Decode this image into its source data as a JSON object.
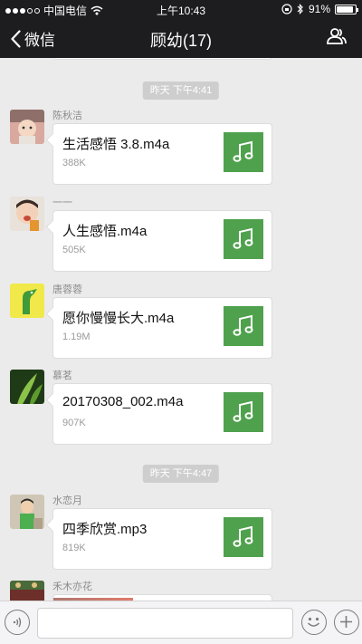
{
  "status_bar": {
    "carrier": "中国电信",
    "time": "上午10:43",
    "battery": "91%",
    "battery_level": 0.91
  },
  "nav": {
    "back_label": "微信",
    "title": "顾幼(17)"
  },
  "timestamps": [
    "昨天 下午4:41",
    "昨天 下午4:47"
  ],
  "messages": [
    {
      "sender": "陈秋洁",
      "file_name": "生活感悟 3.8.m4a",
      "file_size": "388K",
      "file_icon": "music-note-icon"
    },
    {
      "sender": "一一",
      "file_name": "人生感悟.m4a",
      "file_size": "505K",
      "file_icon": "music-note-icon"
    },
    {
      "sender": "唐蓉蓉",
      "file_name": "愿你慢慢长大.m4a",
      "file_size": "1.19M",
      "file_icon": "music-note-icon"
    },
    {
      "sender": "慕茗",
      "file_name": "20170308_002.m4a",
      "file_size": "907K",
      "file_icon": "music-note-icon"
    },
    {
      "sender": "水恋月",
      "file_name": "四季欣赏.mp3",
      "file_size": "819K",
      "file_icon": "music-note-icon"
    },
    {
      "sender": "禾木亦花"
    }
  ],
  "input_bar": {
    "voice_icon": "voice-icon",
    "emoji_icon": "emoji-icon",
    "plus_icon": "plus-icon"
  },
  "colors": {
    "bar_dark": "#1d1d1f",
    "chat_bg": "#ebebeb",
    "music_tile": "#4fa14d"
  }
}
